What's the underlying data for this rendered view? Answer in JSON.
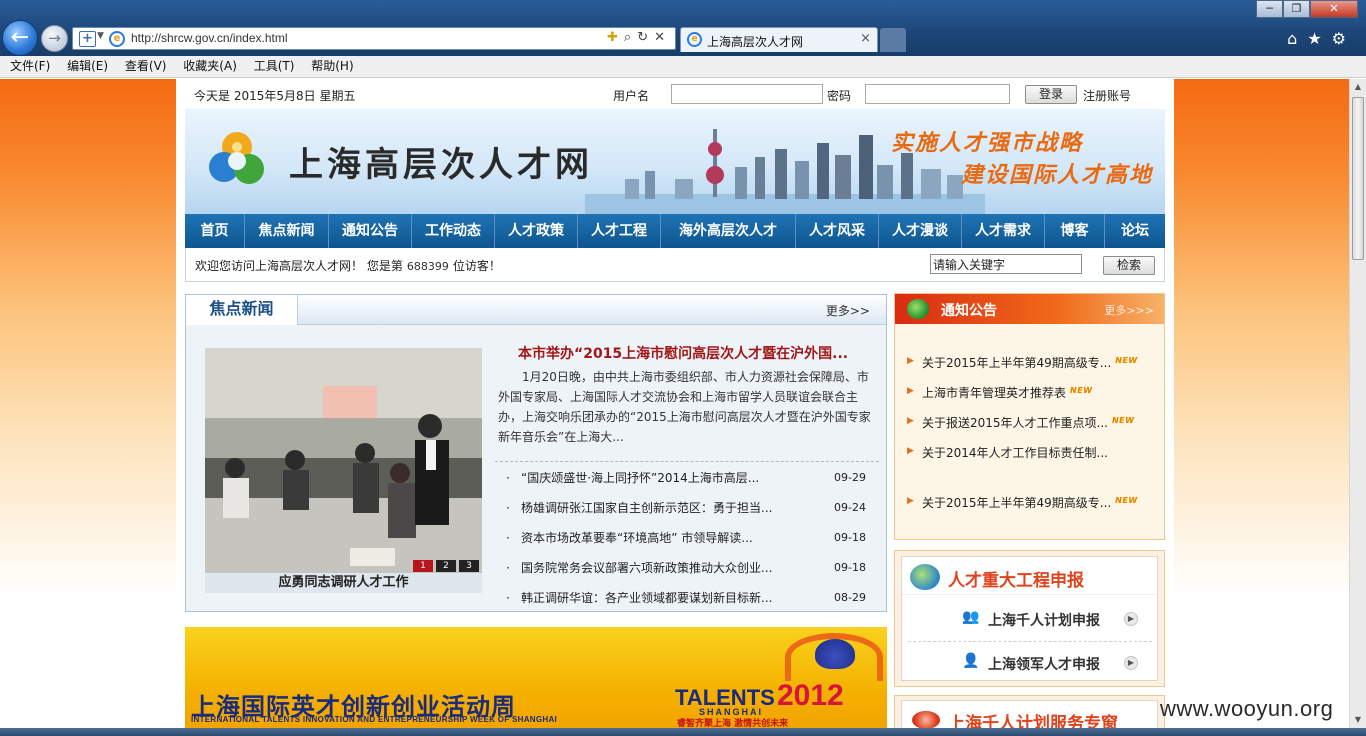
{
  "browser": {
    "url": "http://shrcw.gov.cn/index.html",
    "tab_title": "上海高层次人才网",
    "tab_close": "×",
    "menu": [
      "文件(F)",
      "编辑(E)",
      "查看(V)",
      "收藏夹(A)",
      "工具(T)",
      "帮助(H)"
    ],
    "window_buttons": {
      "min": "─",
      "max": "❐",
      "close": "✕"
    },
    "tools_icons": [
      "home-icon",
      "favorites-icon",
      "settings-icon"
    ]
  },
  "topbar": {
    "date_text": "今天是  2015年5月8日  星期五",
    "username_label": "用户名",
    "password_label": "密码",
    "login_button": "登录",
    "register_link": "注册账号"
  },
  "banner": {
    "site_title": "上海高层次人才网",
    "slogan_1": "实施人才强市战略",
    "slogan_2": "建设国际人才高地"
  },
  "nav": {
    "items": [
      "首页",
      "焦点新闻",
      "通知公告",
      "工作动态",
      "人才政策",
      "人才工程",
      "海外高层次人才",
      "人才风采",
      "人才漫谈",
      "人才需求",
      "博客",
      "论坛"
    ]
  },
  "welcome": {
    "prefix": "欢迎您访问上海高层次人才网！  您是第",
    "visitor_count": "688399",
    "suffix": "位访客！",
    "search_value": "请输入关键字",
    "search_button": "检索"
  },
  "focus_news": {
    "title": "焦点新闻",
    "more": "更多>>",
    "photo_caption": "应勇同志调研人才工作",
    "photo_pages": [
      "1",
      "2",
      "3"
    ],
    "headline": "本市举办“2015上海市慰问高层次人才暨在沪外国...",
    "summary": "1月20日晚，由中共上海市委组织部、市人力资源社会保障局、市外国专家局、上海国际人才交流协会和上海市留学人员联谊会联合主办，上海交响乐团承办的“2015上海市慰问高层次人才暨在沪外国专家新年音乐会”在上海大...",
    "items": [
      {
        "title": "“国庆颂盛世·海上同抒怀”2014上海市高层...",
        "date": "09-29"
      },
      {
        "title": "杨雄调研张江国家自主创新示范区：勇于担当...",
        "date": "09-24"
      },
      {
        "title": "资本市场改革要奉“环境高地” 市领导解读...",
        "date": "09-18"
      },
      {
        "title": "国务院常务会议部署六项新政策推动大众创业...",
        "date": "09-18"
      },
      {
        "title": "韩正调研华谊：各产业领域都要谋划新目标新...",
        "date": "08-29"
      }
    ]
  },
  "notice": {
    "title": "通知公告",
    "more": "更多>>>",
    "items": [
      {
        "title": "关于2015年上半年第49期高级专...",
        "new": "NEW"
      },
      {
        "title": "上海市青年管理英才推荐表",
        "new": "NEW"
      },
      {
        "title": "关于报送2015年人才工作重点项...",
        "new": "NEW"
      },
      {
        "title": "关于2014年人才工作目标责任制...",
        "new": ""
      },
      {
        "title": "关于2015年上半年第49期高级专...",
        "new": "NEW"
      }
    ]
  },
  "projects": {
    "title": "人才重大工程申报",
    "items": [
      {
        "label": "上海千人计划申报"
      },
      {
        "label": "上海领军人才申报"
      }
    ]
  },
  "service": {
    "title": "上海千人计划服务专窗"
  },
  "event_banner": {
    "cn_title": "上海国际英才创新创业活动周",
    "en_title": "INTERNATIONAL TALENTS INNOVATION AND ENTREPRENEURSHIP WEEK OF SHANGHAI",
    "talents": "TALENTS",
    "year": "2012",
    "shanghai": "SHANGHAI",
    "motto": "睿智齐聚上海  激情共创未来"
  },
  "watermark": "www.wooyun.org",
  "colors": {
    "nav_blue": "#0d568f",
    "headline_red": "#a11818",
    "page_orange": "#f46a12",
    "new_orange": "#e58500"
  }
}
